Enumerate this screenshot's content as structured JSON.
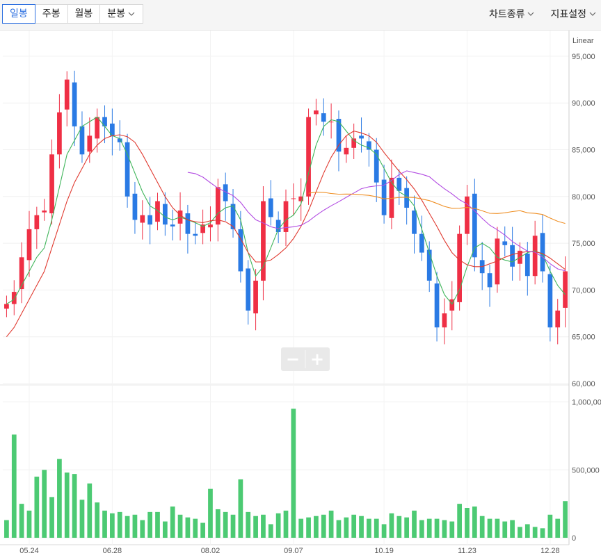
{
  "toolbar": {
    "tabs": [
      {
        "label": "일봉",
        "active": true
      },
      {
        "label": "주봉",
        "active": false
      },
      {
        "label": "월봉",
        "active": false
      },
      {
        "label": "분봉",
        "active": false,
        "has_dropdown": true
      }
    ],
    "chart_type_menu": "차트종류",
    "indicator_menu": "지표설정"
  },
  "colors": {
    "up": "#ef2f45",
    "down": "#2a7ae4",
    "ma5": "#3fb55a",
    "ma20": "#e0392f",
    "ma60": "#b24be2",
    "ma120": "#ef8f24",
    "volume": "#4cca73",
    "active_tab": "#2c6fe0"
  },
  "chart_data": {
    "type": "candlestick",
    "scale_label": "Linear",
    "price_axis": {
      "ticks": [
        "95,000",
        "90,000",
        "85,000",
        "80,000",
        "75,000",
        "70,000",
        "65,000",
        "60,000"
      ],
      "range": [
        60000,
        97000
      ]
    },
    "volume_axis": {
      "ticks": [
        "1,000,000",
        "500,000",
        "0"
      ],
      "range": [
        0,
        1100000
      ]
    },
    "x_labels": [
      "05.24",
      "06.28",
      "08.02",
      "09.07",
      "10.19",
      "11.23",
      "12.28"
    ],
    "zoom_controls": [
      "−",
      "+"
    ],
    "close": [
      68500,
      69800,
      73500,
      76500,
      78000,
      78500,
      84500,
      89000,
      92500,
      87500,
      84500,
      86500,
      88500,
      87500,
      86500,
      85800,
      80000,
      77500,
      78000,
      77000,
      79500,
      77000,
      76800,
      78500,
      76000,
      75800,
      77000,
      77000,
      81000,
      79500,
      76500,
      72000,
      67800,
      71000,
      79500,
      77800,
      76200,
      79500,
      79800,
      80000,
      88500,
      89200,
      88000,
      88000,
      84800,
      85200,
      86200,
      86200,
      85000,
      81500,
      78000,
      82000,
      80600,
      78800,
      76000,
      74000,
      71000,
      66000,
      67500,
      69000,
      76000,
      80000,
      73500,
      71800,
      70300,
      75500,
      74800,
      72500,
      74200,
      71500,
      75800,
      72000,
      66000,
      67800,
      72000
    ],
    "volume": [
      130000,
      760000,
      250000,
      200000,
      450000,
      500000,
      300000,
      580000,
      480000,
      470000,
      280000,
      400000,
      260000,
      200000,
      180000,
      190000,
      160000,
      170000,
      130000,
      190000,
      190000,
      120000,
      230000,
      170000,
      150000,
      140000,
      110000,
      360000,
      210000,
      190000,
      170000,
      430000,
      190000,
      160000,
      170000,
      100000,
      180000,
      200000,
      950000,
      140000,
      150000,
      160000,
      170000,
      200000,
      130000,
      150000,
      170000,
      160000,
      140000,
      140000,
      100000,
      180000,
      160000,
      150000,
      200000,
      130000,
      140000,
      140000,
      130000,
      120000,
      250000,
      220000,
      230000,
      160000,
      140000,
      140000,
      120000,
      130000,
      80000,
      100000,
      80000,
      70000,
      170000,
      140000,
      270000
    ],
    "ma5": [
      68500,
      69000,
      70500,
      72000,
      73500,
      74500,
      77500,
      81000,
      84500,
      86000,
      87500,
      88000,
      88500,
      87500,
      86500,
      86200,
      84500,
      82500,
      80500,
      79000,
      78500,
      77800,
      77500,
      77800,
      77500,
      77200,
      76800,
      77200,
      78200,
      78800,
      79000,
      77500,
      74000,
      71500,
      72500,
      74500,
      76500,
      77500,
      78000,
      79200,
      82500,
      85500,
      87500,
      88200,
      88000,
      87000,
      86000,
      85500,
      85200,
      84500,
      83000,
      81500,
      80500,
      80000,
      79000,
      76500,
      74000,
      71500,
      69500,
      68500,
      70000,
      72500,
      74500,
      75000,
      74500,
      73500,
      73200,
      73000,
      73500,
      74000,
      74200,
      73800,
      72000,
      70500,
      69500
    ],
    "ma20": [
      65000,
      66000,
      67500,
      69000,
      70500,
      72000,
      74500,
      77000,
      79500,
      81500,
      83000,
      84500,
      85500,
      86200,
      86500,
      86600,
      86400,
      85800,
      84500,
      83000,
      81500,
      80000,
      78800,
      78000,
      77500,
      77300,
      77200,
      77400,
      77500,
      77300,
      76800,
      75500,
      74000,
      73000,
      73000,
      73200,
      73800,
      74500,
      75500,
      76800,
      78500,
      80500,
      82500,
      84200,
      85500,
      86500,
      87000,
      86800,
      86500,
      85800,
      84700,
      83700,
      82700,
      81800,
      80800,
      79600,
      78200,
      76800,
      75300,
      74000,
      73200,
      72700,
      72500,
      72500,
      72800,
      73100,
      73500,
      73800,
      74000,
      74100,
      74100,
      73900,
      73400,
      72800,
      72200
    ],
    "ma60": [
      null,
      null,
      null,
      null,
      null,
      null,
      null,
      null,
      null,
      null,
      null,
      null,
      null,
      null,
      null,
      null,
      null,
      null,
      null,
      null,
      null,
      null,
      null,
      null,
      null,
      null,
      null,
      null,
      null,
      null,
      null,
      null,
      null,
      null,
      null,
      null,
      null,
      null,
      null,
      null,
      null,
      null,
      null,
      null,
      null,
      null,
      null,
      null,
      null,
      null,
      null,
      null,
      null,
      null,
      null,
      null,
      null,
      null,
      null,
      null,
      null,
      null,
      null,
      null,
      null,
      null,
      null,
      null,
      null,
      null,
      null,
      null,
      null,
      null,
      null
    ],
    "ma120": [
      null,
      null,
      null,
      null,
      null,
      null,
      null,
      null,
      null,
      null,
      null,
      null,
      null,
      null,
      null,
      null,
      null,
      null,
      null,
      null,
      null,
      null,
      null,
      null,
      null,
      null,
      null,
      null,
      null,
      null,
      null,
      null,
      null,
      null,
      null,
      null,
      null,
      null,
      null,
      null,
      null,
      null,
      null,
      null,
      null,
      null,
      null,
      null,
      null,
      null,
      null,
      null,
      null,
      null,
      null,
      null,
      null,
      null,
      null,
      null,
      null,
      null,
      null,
      null,
      null,
      null,
      null,
      null,
      null,
      null,
      null,
      null,
      null,
      null,
      null
    ]
  }
}
